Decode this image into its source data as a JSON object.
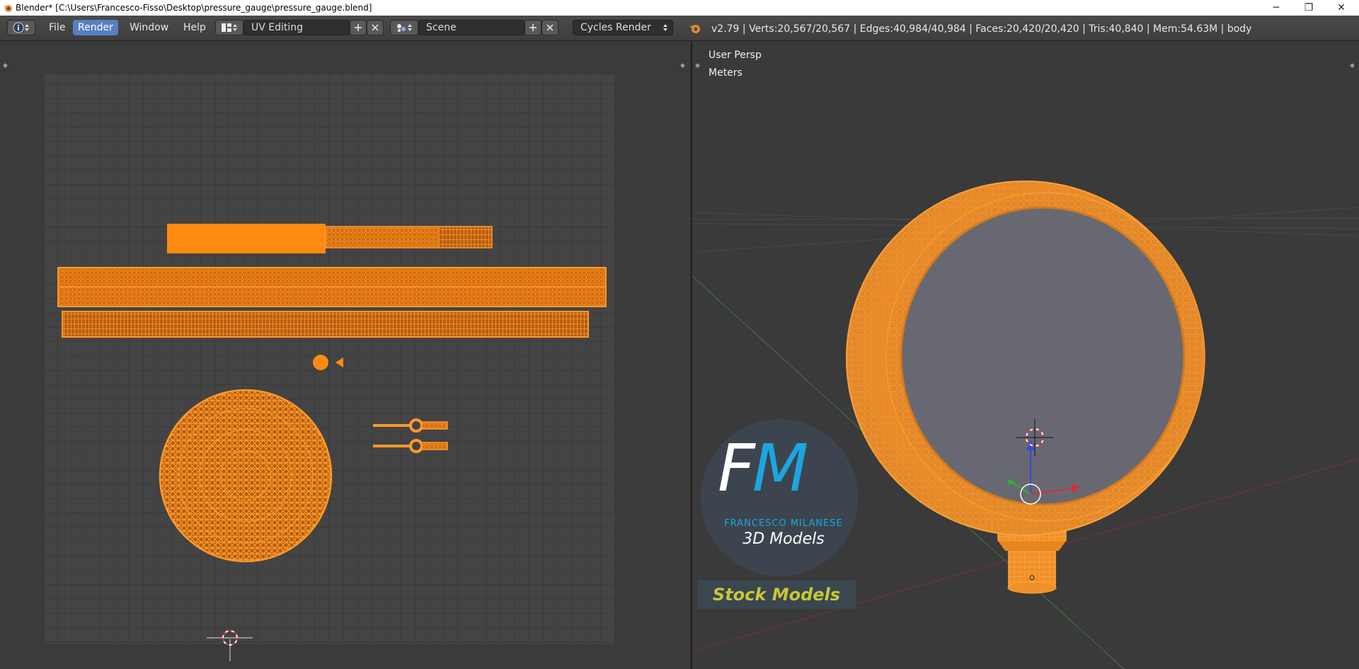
{
  "window": {
    "title": "Blender* [C:\\Users\\Francesco-Fisso\\Desktop\\pressure_gauge\\pressure_gauge.blend]",
    "controls": {
      "minimize": "─",
      "restore": "❐",
      "close": "✕"
    }
  },
  "header": {
    "menus": [
      {
        "label": "File"
      },
      {
        "label": "Render",
        "active": true
      },
      {
        "label": "Window"
      },
      {
        "label": "Help"
      }
    ],
    "screen_layout": "UV Editing",
    "scene": "Scene",
    "render_engine": "Cycles Render",
    "stats": "v2.79 | Verts:20,567/20,567 | Edges:40,984/40,984 | Faces:20,420/20,420 | Tris:40,840 | Mem:54.63M | body"
  },
  "viewport": {
    "view_name": "User Persp",
    "units": "Meters"
  },
  "watermark": {
    "logo_letters": "FM",
    "author": "FRANCESCO MILANESE",
    "subtitle": "3D Models",
    "badge": "Stock Models"
  },
  "icons": [
    "blender-logo-icon",
    "info-editor-icon",
    "layout-icon",
    "scene-icon",
    "add-icon",
    "close-icon",
    "render-engine-icon"
  ],
  "colors": {
    "mesh": "#ff8c1a",
    "accent": "#5680c2",
    "watermark_blue": "#1ba6e0",
    "badge_text": "#c8c832"
  }
}
